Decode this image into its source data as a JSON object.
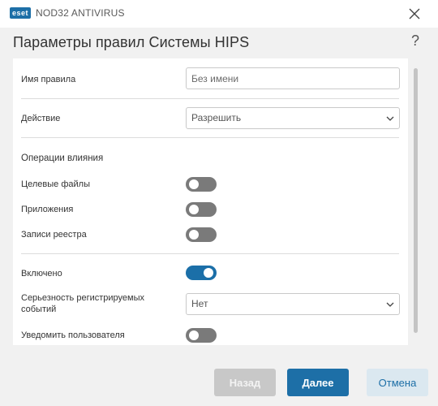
{
  "window": {
    "brand": "eset",
    "product": "NOD32 ANTIVIRUS",
    "close_icon": "close-icon"
  },
  "dialog": {
    "title": "Параметры правил Системы HIPS",
    "help": "?"
  },
  "form": {
    "rule_name": {
      "label": "Имя правила",
      "placeholder": "Без имени",
      "value": ""
    },
    "action": {
      "label": "Действие",
      "selected": "Разрешить",
      "icon": "chevron-down-icon"
    },
    "operations_label": "Операции влияния",
    "target_files": {
      "label": "Целевые файлы",
      "enabled": false
    },
    "applications": {
      "label": "Приложения",
      "enabled": false
    },
    "registry": {
      "label": "Записи реестра",
      "enabled": false
    },
    "enabled": {
      "label": "Включено",
      "enabled": true
    },
    "severity": {
      "label_line1": "Серьезность регистрируемых",
      "label_line2": "событий",
      "selected": "Нет",
      "icon": "chevron-down-icon"
    },
    "notify_user": {
      "label": "Уведомить пользователя",
      "enabled": false
    }
  },
  "buttons": {
    "back": "Назад",
    "next": "Далее",
    "cancel": "Отмена"
  },
  "colors": {
    "accent": "#1d6fa7",
    "toggle_off": "#7a7a7a",
    "background": "#f1f1f1"
  }
}
